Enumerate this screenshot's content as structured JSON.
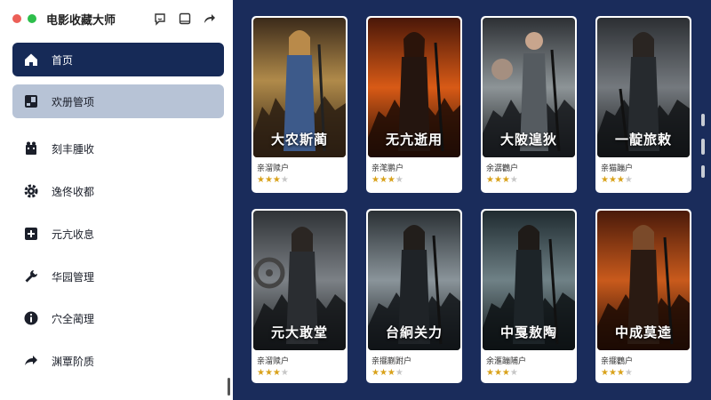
{
  "app": {
    "title": "电影收藏大师"
  },
  "sidebar": {
    "items": [
      {
        "label": "首页",
        "icon": "home-icon"
      },
      {
        "label": "欢册管项",
        "icon": "collection-icon"
      },
      {
        "label": "刻丰腫收",
        "icon": "film-reel-icon"
      },
      {
        "label": "逸佟收都",
        "icon": "gear-icon"
      },
      {
        "label": "元亢收息",
        "icon": "plus-icon"
      },
      {
        "label": "华园管理",
        "icon": "wrench-icon"
      },
      {
        "label": "穴全蔺理",
        "icon": "info-icon"
      },
      {
        "label": "渊覃阶质",
        "icon": "share-arrow-icon"
      }
    ]
  },
  "movies": [
    {
      "title": "大农斯蔺",
      "meta": "亲溜赎户",
      "rating": 3
    },
    {
      "title": "无亢逝用",
      "meta": "亲滗鹏户",
      "rating": 3
    },
    {
      "title": "大陂遑狄",
      "meta": "余潺鸛户",
      "rating": 3
    },
    {
      "title": "一靛旅敕",
      "meta": "亲猫蹦户",
      "rating": 3
    },
    {
      "title": "元大敢堂",
      "meta": "亲溜赎户",
      "rating": 3
    },
    {
      "title": "台絅关力",
      "meta": "亲擺蒯跗户",
      "rating": 3
    },
    {
      "title": "中戛敖陶",
      "meta": "余滙蹦陠户",
      "rating": 3
    },
    {
      "title": "中成莫逵",
      "meta": "亲擺鸛户",
      "rating": 3
    }
  ],
  "colors": {
    "accent": "#162a57",
    "secondary": "#b7c3d6",
    "star": "#d9a21b",
    "background": "#1a2c5b"
  }
}
